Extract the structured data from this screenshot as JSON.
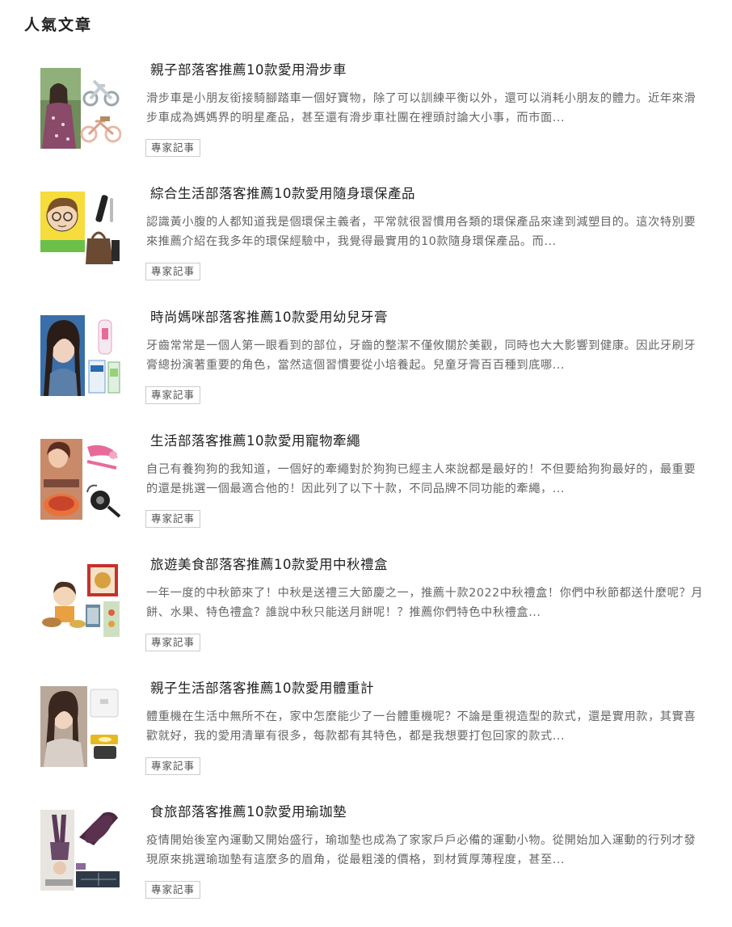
{
  "section": {
    "title": "人氣文章"
  },
  "articles": [
    {
      "title": "親子部落客推薦10款愛用滑步車",
      "excerpt": "滑步車是小朋友銜接騎腳踏車一個好寶物，除了可以訓練平衡以外，還可以消耗小朋友的體力。近年來滑步車成為媽媽界的明星產品，甚至還有滑步車社團在裡頭討論大小事，而市面...",
      "tag": "專家記事"
    },
    {
      "title": "綜合生活部落客推薦10款愛用隨身環保產品",
      "excerpt": "認識黃小腹的人都知道我是個環保主義者，平常就很習慣用各類的環保產品來達到減塑目的。這次特別要來推薦介紹在我多年的環保經驗中，我覺得最實用的10款隨身環保產品。而...",
      "tag": "專家記事"
    },
    {
      "title": "時尚媽咪部落客推薦10款愛用幼兒牙膏",
      "excerpt": "牙齒常常是一個人第一眼看到的部位，牙齒的整潔不僅攸關於美觀，同時也大大影響到健康。因此牙刷牙膏總扮演著重要的角色，當然這個習慣要從小培養起。兒童牙膏百百種到底哪...",
      "tag": "專家記事"
    },
    {
      "title": "生活部落客推薦10款愛用寵物牽繩",
      "excerpt": "自己有養狗狗的我知道，一個好的牽繩對於狗狗已經主人來說都是最好的！不但要給狗狗最好的，最重要的還是挑選一個最適合他的！因此列了以下十款，不同品牌不同功能的牽繩，...",
      "tag": "專家記事"
    },
    {
      "title": "旅遊美食部落客推薦10款愛用中秋禮盒",
      "excerpt": "一年一度的中秋節來了！中秋是送禮三大節慶之一，推薦十款2022中秋禮盒！你們中秋節都送什麼呢？月餅、水果、特色禮盒？誰說中秋只能送月餅呢！？推薦你們特色中秋禮盒...",
      "tag": "專家記事"
    },
    {
      "title": "親子生活部落客推薦10款愛用體重計",
      "excerpt": "體重機在生活中無所不在，家中怎麼能少了一台體重機呢？不論是重視造型的款式，還是實用款，其實喜歡就好，我的愛用清單有很多，每款都有其特色，都是我想要打包回家的款式...",
      "tag": "專家記事"
    },
    {
      "title": "食旅部落客推薦10款愛用瑜珈墊",
      "excerpt": "疫情開始後室內運動又開始盛行，瑜珈墊也成為了家家戶戶必備的運動小物。從開始加入運動的行列才發現原來挑選瑜珈墊有這麼多的眉角，從最粗淺的價格，到材質厚薄程度，甚至...",
      "tag": "專家記事"
    }
  ]
}
